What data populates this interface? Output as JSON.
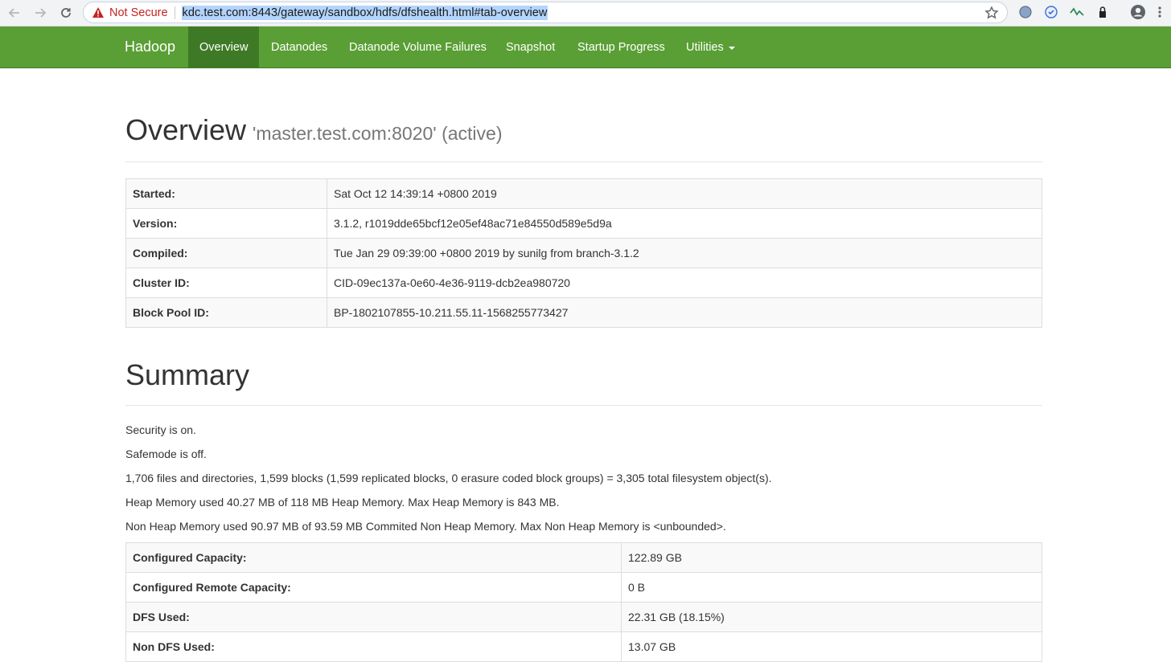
{
  "browser": {
    "not_secure": "Not Secure",
    "url": "kdc.test.com:8443/gateway/sandbox/hdfs/dfshealth.html#tab-overview",
    "icons": [
      "back-icon",
      "forward-icon",
      "reload-icon",
      "warning-icon",
      "star-icon",
      "extension-icons",
      "profile-icon",
      "menu-icon"
    ]
  },
  "navbar": {
    "brand": "Hadoop",
    "items": [
      {
        "label": "Overview",
        "active": true
      },
      {
        "label": "Datanodes"
      },
      {
        "label": "Datanode Volume Failures"
      },
      {
        "label": "Snapshot"
      },
      {
        "label": "Startup Progress"
      },
      {
        "label": "Utilities",
        "dropdown": true
      }
    ],
    "color": "#5a9f35",
    "active_color": "#3e7a26"
  },
  "overview": {
    "title": "Overview",
    "subtitle": "'master.test.com:8020' (active)",
    "rows": [
      {
        "key": "Started:",
        "value": "Sat Oct 12 14:39:14 +0800 2019"
      },
      {
        "key": "Version:",
        "value": "3.1.2, r1019dde65bcf12e05ef48ac71e84550d589e5d9a"
      },
      {
        "key": "Compiled:",
        "value": "Tue Jan 29 09:39:00 +0800 2019 by sunilg from branch-3.1.2"
      },
      {
        "key": "Cluster ID:",
        "value": "CID-09ec137a-0e60-4e36-9119-dcb2ea980720"
      },
      {
        "key": "Block Pool ID:",
        "value": "BP-1802107855-10.211.55.11-1568255773427"
      }
    ]
  },
  "summary": {
    "title": "Summary",
    "lines": [
      "Security is on.",
      "Safemode is off.",
      "1,706 files and directories, 1,599 blocks (1,599 replicated blocks, 0 erasure coded block groups) = 3,305 total filesystem object(s).",
      "Heap Memory used 40.27 MB of 118 MB Heap Memory. Max Heap Memory is 843 MB.",
      "Non Heap Memory used 90.97 MB of 93.59 MB Commited Non Heap Memory. Max Non Heap Memory is <unbounded>."
    ],
    "capacity": [
      {
        "key": "Configured Capacity:",
        "value": "122.89 GB"
      },
      {
        "key": "Configured Remote Capacity:",
        "value": "0 B"
      },
      {
        "key": "DFS Used:",
        "value": "22.31 GB (18.15%)"
      },
      {
        "key": "Non DFS Used:",
        "value": "13.07 GB"
      }
    ]
  }
}
